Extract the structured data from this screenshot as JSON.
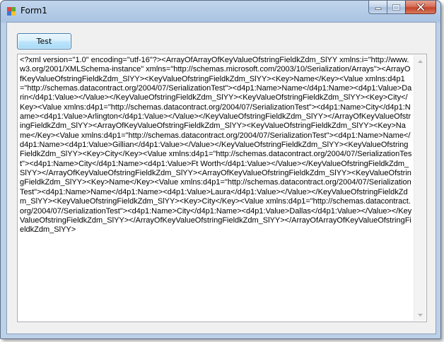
{
  "window": {
    "title": "Form1",
    "controls": {
      "minimize_icon": "minimize-icon",
      "maximize_icon": "maximize-icon",
      "close_icon": "close-icon"
    }
  },
  "toolbar": {
    "test_label": "Test"
  },
  "output": {
    "text": "<?xml version=\"1.0\" encoding=\"utf-16\"?><ArrayOfArrayOfKeyValueOfstringFieldkZdm_SlYY xmlns:i=\"http://www.w3.org/2001/XMLSchema-instance\" xmlns=\"http://schemas.microsoft.com/2003/10/Serialization/Arrays\"><ArrayOfKeyValueOfstringFieldkZdm_SlYY><KeyValueOfstringFieldkZdm_SlYY><Key>Name</Key><Value xmlns:d4p1=\"http://schemas.datacontract.org/2004/07/SerializationTest\"><d4p1:Name>Name</d4p1:Name><d4p1:Value>Darin</d4p1:Value></Value></KeyValueOfstringFieldkZdm_SlYY><KeyValueOfstringFieldkZdm_SlYY><Key>City</Key><Value xmlns:d4p1=\"http://schemas.datacontract.org/2004/07/SerializationTest\"><d4p1:Name>City</d4p1:Name><d4p1:Value>Arlington</d4p1:Value></Value></KeyValueOfstringFieldkZdm_SlYY></ArrayOfKeyValueOfstringFieldkZdm_SlYY><ArrayOfKeyValueOfstringFieldkZdm_SlYY><KeyValueOfstringFieldkZdm_SlYY><Key>Name</Key><Value xmlns:d4p1=\"http://schemas.datacontract.org/2004/07/SerializationTest\"><d4p1:Name>Name</d4p1:Name><d4p1:Value>Gillian</d4p1:Value></Value></KeyValueOfstringFieldkZdm_SlYY><KeyValueOfstringFieldkZdm_SlYY><Key>City</Key><Value xmlns:d4p1=\"http://schemas.datacontract.org/2004/07/SerializationTest\"><d4p1:Name>City</d4p1:Name><d4p1:Value>Ft Worth</d4p1:Value></Value></KeyValueOfstringFieldkZdm_SlYY></ArrayOfKeyValueOfstringFieldkZdm_SlYY><ArrayOfKeyValueOfstringFieldkZdm_SlYY><KeyValueOfstringFieldkZdm_SlYY><Key>Name</Key><Value xmlns:d4p1=\"http://schemas.datacontract.org/2004/07/SerializationTest\"><d4p1:Name>Name</d4p1:Name><d4p1:Value>Laura</d4p1:Value></Value></KeyValueOfstringFieldkZdm_SlYY><KeyValueOfstringFieldkZdm_SlYY><Key>City</Key><Value xmlns:d4p1=\"http://schemas.datacontract.org/2004/07/SerializationTest\"><d4p1:Name>City</d4p1:Name><d4p1:Value>Dallas</d4p1:Value></Value></KeyValueOfstringFieldkZdm_SlYY></ArrayOfKeyValueOfstringFieldkZdm_SlYY></ArrayOfArrayOfKeyValueOfstringFieldkZdm_SlYY>"
  },
  "scrollbar": {
    "up_icon": "scroll-up-arrow-icon",
    "down_icon": "scroll-down-arrow-icon"
  }
}
